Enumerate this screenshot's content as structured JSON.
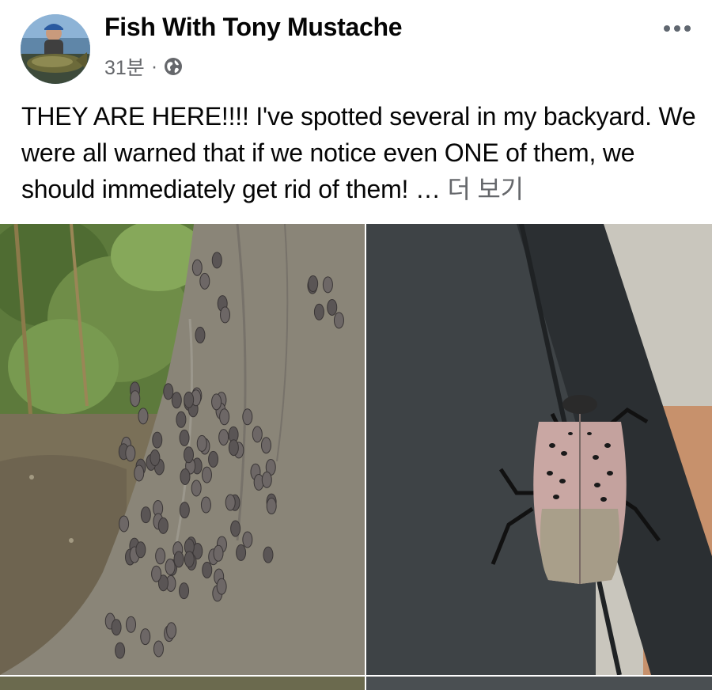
{
  "post": {
    "author": "Fish With Tony Mustache",
    "time": "31분",
    "separator": "·",
    "privacy_icon": "globe-icon",
    "more_icon": "more-dots-icon",
    "text": "THEY ARE HERE!!!! I've spotted several in my backyard. We were all warned that if we notice even ONE of them, we should immediately get rid of them! ",
    "ellipsis": "…",
    "see_more": "더 보기"
  },
  "photos": [
    {
      "subject": "tree trunk covered with many spotted lanternflies in a backyard"
    },
    {
      "subject": "single spotted lanternfly on a dark gray railing"
    }
  ],
  "colors": {
    "text": "#050505",
    "secondary": "#65676b",
    "background": "#ffffff"
  }
}
